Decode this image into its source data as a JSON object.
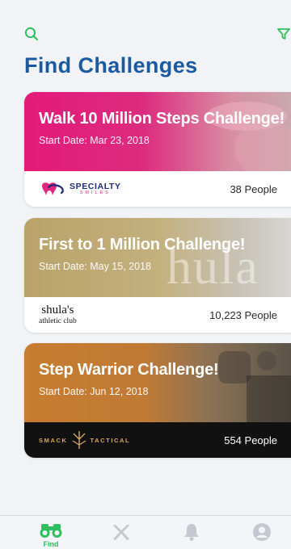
{
  "header": {
    "title": "Find Challenges",
    "search_icon": "search-icon",
    "filter_icon": "filter-icon"
  },
  "colors": {
    "accent_green": "#2fbf5f",
    "title_blue": "#1a5aa0",
    "inactive_icon": "#c6c8cf"
  },
  "challenges": [
    {
      "title": "Walk 10 Million Steps Challenge!",
      "start_date": "Start Date: Mar 23, 2018",
      "sponsor_line1": "SPECIALTY",
      "sponsor_line2": "SMILES",
      "people": "38 People"
    },
    {
      "title": "First to 1 Million Challenge!",
      "start_date": "Start Date: May 15, 2018",
      "watermark": "hula",
      "sponsor_line1": "shula's",
      "sponsor_line2": "athletic club",
      "people": "10,223 People"
    },
    {
      "title": "Step Warrior Challenge!",
      "start_date": "Start Date: Jun 12, 2018",
      "sponsor_line1": "SMACK",
      "sponsor_line2": "TACTICAL",
      "people": "554 People"
    }
  ],
  "tabbar": {
    "tabs": [
      {
        "label": "Find",
        "icon": "binoculars-icon",
        "active": true
      },
      {
        "label": "",
        "icon": "crossed-swords-icon",
        "active": false
      },
      {
        "label": "",
        "icon": "bell-icon",
        "active": false
      },
      {
        "label": "",
        "icon": "profile-icon",
        "active": false
      }
    ]
  }
}
